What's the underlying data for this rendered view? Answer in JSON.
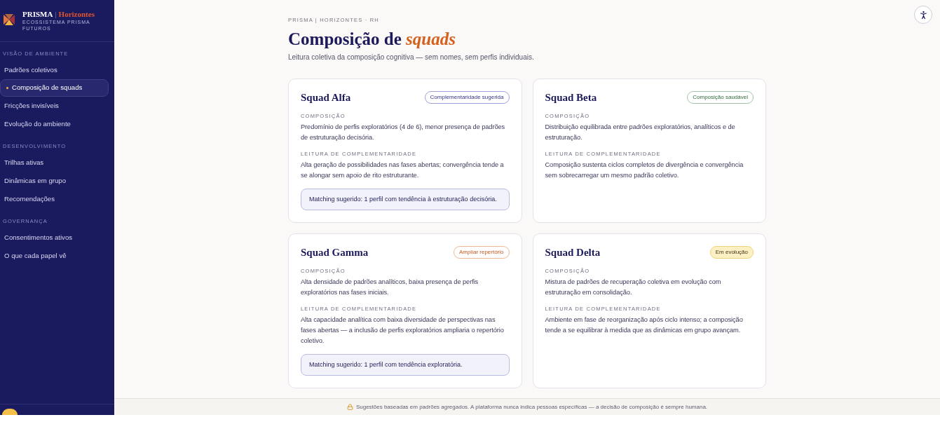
{
  "sidebar": {
    "brand": {
      "name": "PRISMA",
      "separator": "|",
      "product": "Horizontes",
      "subtitle": "ECOSSISTEMA PRISMA FUTUROS"
    },
    "sections": [
      {
        "title": "VISÃO DE AMBIENTE",
        "items": [
          {
            "label": "Padrões coletivos",
            "selected": false
          },
          {
            "label": "Composição de squads",
            "selected": true
          },
          {
            "label": "Fricções invisíveis",
            "selected": false
          },
          {
            "label": "Evolução do ambiente",
            "selected": false
          }
        ]
      },
      {
        "title": "DESENVOLVIMENTO",
        "items": [
          {
            "label": "Trilhas ativas",
            "selected": false
          },
          {
            "label": "Dinâmicas em grupo",
            "selected": false
          },
          {
            "label": "Recomendações",
            "selected": false
          }
        ]
      },
      {
        "title": "GOVERNANÇA",
        "items": [
          {
            "label": "Consentimentos ativos",
            "selected": false
          },
          {
            "label": "O que cada papel vê",
            "selected": false
          }
        ]
      }
    ]
  },
  "header": {
    "breadcrumb": "PRISMA | HORIZONTES · RH",
    "title": "Composição de *squads*",
    "subtitle": "Leitura coletiva da composição cognitiva — sem nomes, sem perfis individuais."
  },
  "squads": [
    {
      "name": "Squad Alfa",
      "badge": {
        "label": "Complementaridade sugerida",
        "kind": "info"
      },
      "sections": [
        {
          "label": "COMPOSIÇÃO",
          "text": "Predomínio de perfis exploratórios (4 de 6), menor presença de padrões de estruturação decisória."
        },
        {
          "label": "LEITURA DE COMPLEMENTARIDADE",
          "text": "Alta geração de possibilidades nas fases abertas; convergência tende a se alongar sem apoio de rito estruturante."
        }
      ],
      "matching": "Matching sugerido: 1 perfil com tendência à estruturação decisória."
    },
    {
      "name": "Squad Beta",
      "badge": {
        "label": "Composição saudável",
        "kind": "success"
      },
      "sections": [
        {
          "label": "COMPOSIÇÃO",
          "text": "Distribuição equilibrada entre padrões exploratórios, analíticos e de estruturação."
        },
        {
          "label": "LEITURA DE COMPLEMENTARIDADE",
          "text": "Composição sustenta ciclos completos de divergência e convergência sem sobrecarregar um mesmo padrão coletivo."
        }
      ]
    },
    {
      "name": "Squad Gamma",
      "badge": {
        "label": "Ampliar repertório",
        "kind": "warning"
      },
      "sections": [
        {
          "label": "COMPOSIÇÃO",
          "text": "Alta densidade de padrões analíticos, baixa presença de perfis exploratórios nas fases iniciais."
        },
        {
          "label": "LEITURA DE COMPLEMENTARIDADE",
          "text": "Alta capacidade analítica com baixa diversidade de perspectivas nas fases abertas — a inclusão de perfis exploratórios ampliaria o repertório coletivo."
        }
      ],
      "matching": "Matching sugerido: 1 perfil com tendência exploratória."
    },
    {
      "name": "Squad Delta",
      "badge": {
        "label": "Em evolução",
        "kind": "progress"
      },
      "sections": [
        {
          "label": "COMPOSIÇÃO",
          "text": "Mistura de padrões de recuperação coletiva em evolução com estruturação em consolidação."
        },
        {
          "label": "LEITURA DE COMPLEMENTARIDADE",
          "text": "Ambiente em fase de reorganização após ciclo intenso; a composição tende a se equilibrar à medida que as dinâmicas em grupo avançam."
        }
      ]
    }
  ],
  "footer": {
    "notice": "Sugestões baseadas em padrões agregados. A plataforma nunca indica pessoas específicas — a decisão de composição é sempre humana."
  }
}
